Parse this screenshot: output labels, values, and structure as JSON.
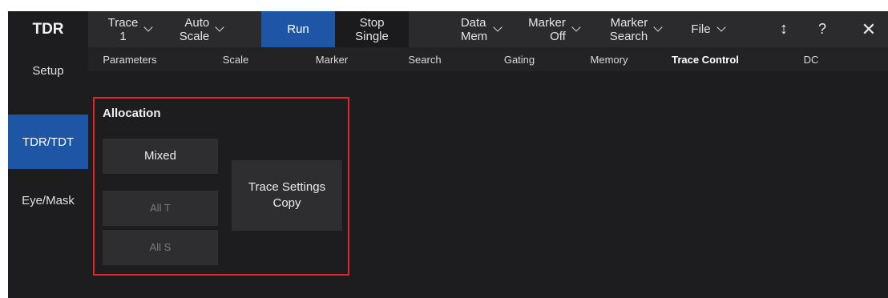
{
  "app": {
    "title": "TDR"
  },
  "toolbar": {
    "trace": {
      "line1": "Trace",
      "line2": "1"
    },
    "autoscale": {
      "line1": "Auto",
      "line2": "Scale"
    },
    "run": "Run",
    "stop_single": {
      "line1": "Stop",
      "line2": "Single"
    },
    "data_mem": {
      "line1": "Data",
      "line2": "Mem"
    },
    "marker_off": {
      "line1": "Marker",
      "line2": "Off"
    },
    "marker_search": {
      "line1": "Marker",
      "line2": "Search"
    },
    "file": "File",
    "arrows_icon": "↕",
    "help_icon": "?",
    "close_icon": "✕"
  },
  "sidebar": {
    "items": [
      {
        "label": "Setup"
      },
      {
        "label": "TDR/TDT",
        "active": true
      },
      {
        "label": "Eye/Mask"
      }
    ]
  },
  "tabs": [
    {
      "label": "Parameters"
    },
    {
      "label": "Scale"
    },
    {
      "label": "Marker"
    },
    {
      "label": "Search"
    },
    {
      "label": "Gating"
    },
    {
      "label": "Memory"
    },
    {
      "label": "Trace Control",
      "active": true
    },
    {
      "label": "DC"
    }
  ],
  "allocation": {
    "title": "Allocation",
    "mixed": "Mixed",
    "all_t": "All T",
    "all_s": "All S",
    "copy": {
      "line1": "Trace Settings",
      "line2": "Copy"
    }
  },
  "colors": {
    "accent": "#1e55a5",
    "highlight_border": "#e0262b",
    "background": "#1d1d1f"
  }
}
